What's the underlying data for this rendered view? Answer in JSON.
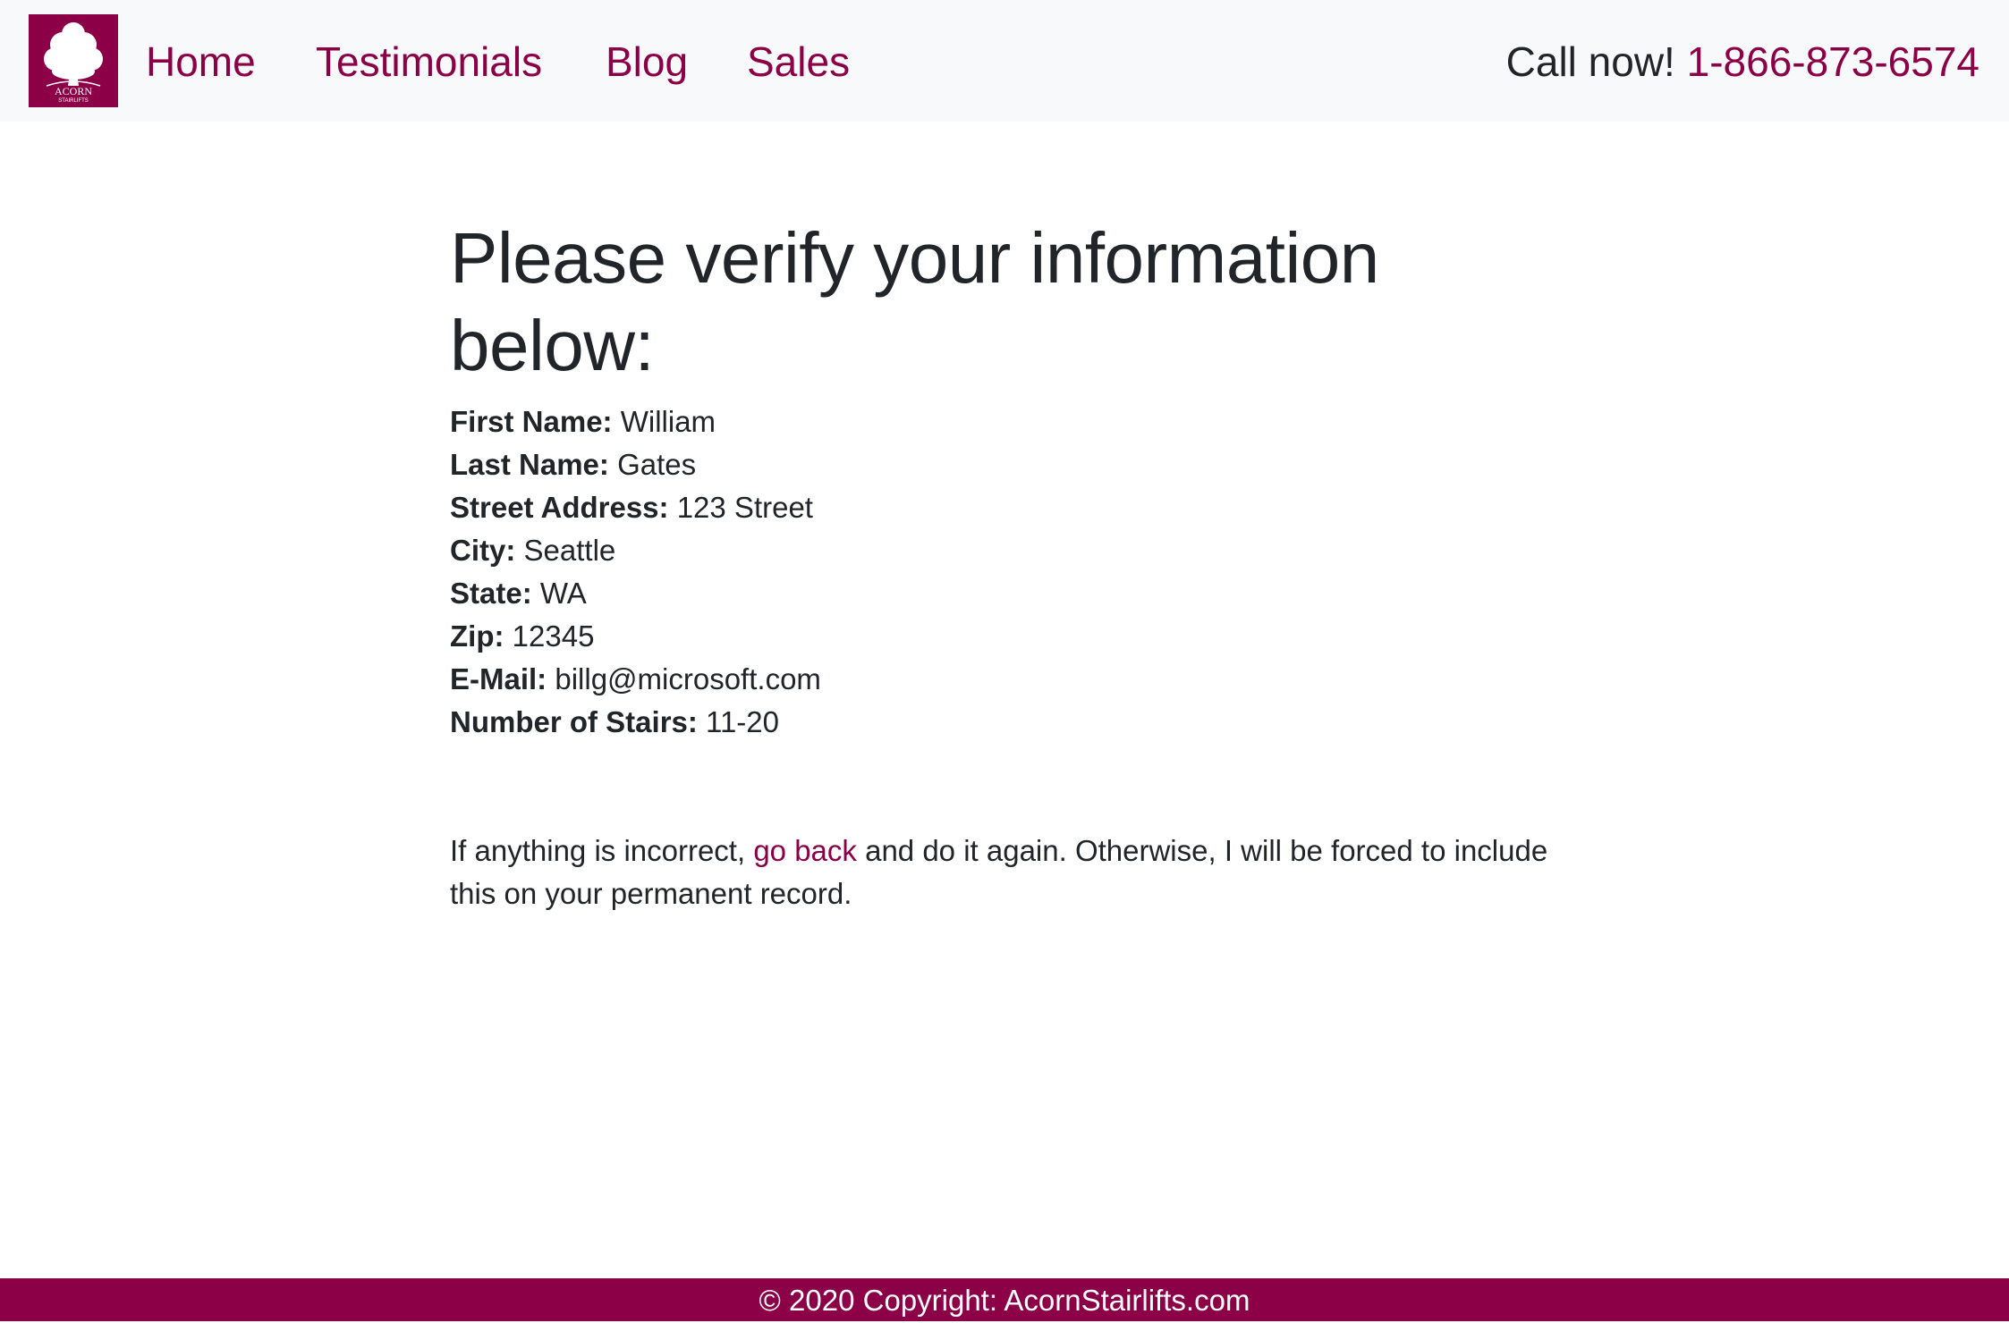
{
  "brand": {
    "logo_text": "ACORN",
    "logo_subtext": "STAIRLIFTS",
    "color": "#8b0046"
  },
  "nav": {
    "links": [
      {
        "label": "Home"
      },
      {
        "label": "Testimonials"
      },
      {
        "label": "Blog"
      },
      {
        "label": "Sales"
      }
    ],
    "call_label": "Call now!",
    "phone": "1-866-873-6574"
  },
  "main": {
    "title": "Please verify your information below:",
    "fields": [
      {
        "label": "First Name:",
        "value": "William"
      },
      {
        "label": "Last Name:",
        "value": "Gates"
      },
      {
        "label": "Street Address:",
        "value": "123 Street"
      },
      {
        "label": "City:",
        "value": "Seattle"
      },
      {
        "label": "State:",
        "value": "WA"
      },
      {
        "label": "Zip:",
        "value": "12345"
      },
      {
        "label": "E-Mail:",
        "value": "billg@microsoft.com"
      },
      {
        "label": "Number of Stairs:",
        "value": "11-20"
      }
    ],
    "notice_before": "If anything is incorrect, ",
    "notice_link": "go back",
    "notice_after": " and do it again. Otherwise, I will be forced to include this on your permanent record."
  },
  "footer": {
    "text": "© 2020 Copyright: AcornStairlifts.com"
  }
}
